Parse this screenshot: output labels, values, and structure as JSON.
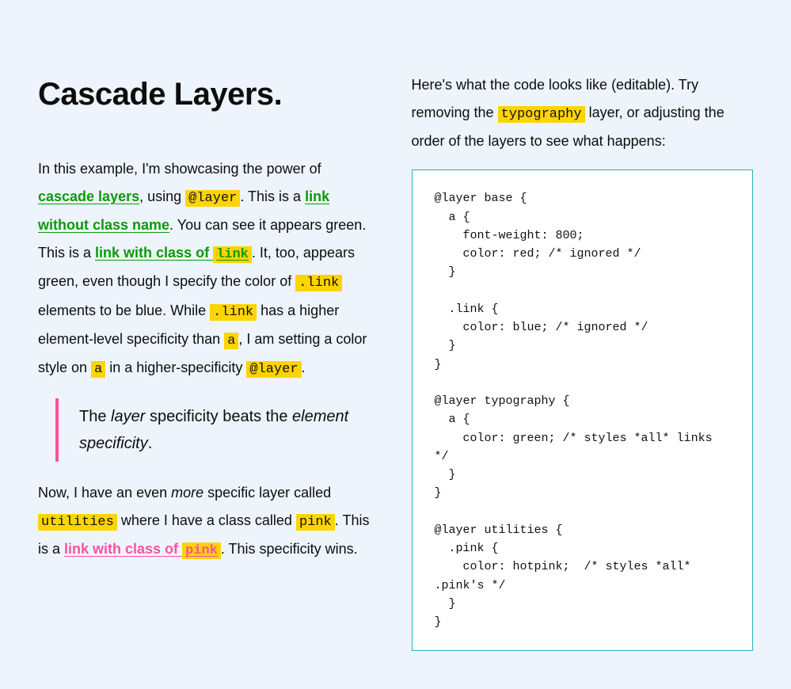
{
  "heading": "Cascade Layers.",
  "left": {
    "p1_a": "In this example, I'm showcasing the power of ",
    "link_cascade": "cascade layers",
    "p1_b": ", using ",
    "code_layer": "@layer",
    "p1_c": ". This is a ",
    "link_noclass": "link without class name",
    "p1_d": ". You can see it appears green. This is a ",
    "link_withclass_pre": "link with class of ",
    "code_link": "link",
    "p1_e": ". It, too, appears green, even though I specify the color of ",
    "code_dotlink1": ".link",
    "p1_f": " elements to be blue. While ",
    "code_dotlink2": ".link",
    "p1_g": " has a higher element-level specificity than ",
    "code_a1": "a",
    "p1_h": ", I am setting a color style on ",
    "code_a2": "a",
    "p1_i": " in a higher-specificity ",
    "code_layer2": "@layer",
    "p1_j": ".",
    "bq_a": "The ",
    "bq_em1": "layer",
    "bq_b": " specificity beats the ",
    "bq_em2": "element specificity",
    "bq_c": ".",
    "p2_a": "Now, I have an even ",
    "p2_em": "more",
    "p2_b": " specific layer called ",
    "code_utilities": "utilities",
    "p2_c": " where I have a class called ",
    "code_pink": "pink",
    "p2_d": ". This is a ",
    "link_pink_pre": "link with class of ",
    "code_pink2": "pink",
    "p2_e": ". This specificity wins."
  },
  "right": {
    "intro_a": "Here's what the code looks like (editable). Try removing the ",
    "code_typography": "typography",
    "intro_b": " layer, or adjusting the order of the layers to see what happens:",
    "code": "@layer base {\n  a {\n    font-weight: 800;\n    color: red; /* ignored */\n  }\n\n  .link {\n    color: blue; /* ignored */\n  }\n}\n\n@layer typography {\n  a {\n    color: green; /* styles *all* links */\n  }\n}\n\n@layer utilities {\n  .pink {\n    color: hotpink;  /* styles *all* .pink's */\n  }\n}"
  }
}
